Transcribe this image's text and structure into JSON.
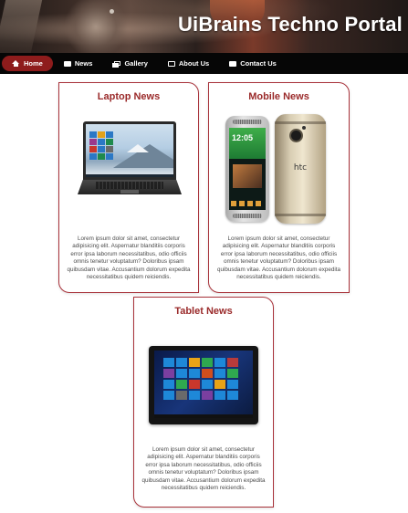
{
  "header": {
    "brand": "UiBrains Techno Portal"
  },
  "nav": [
    {
      "label": "Home",
      "icon": "home-icon",
      "active": true
    },
    {
      "label": "News",
      "icon": "newspaper-icon"
    },
    {
      "label": "Gallery",
      "icon": "gallery-icon"
    },
    {
      "label": "About Us",
      "icon": "address-card-icon"
    },
    {
      "label": "Contact Us",
      "icon": "envelope-icon"
    }
  ],
  "cards": [
    {
      "title": "Laptop News",
      "image": "laptop-image",
      "text": "Lorem ipsum dolor sit amet, consectetur adipisicing elit. Aspernatur blanditiis corporis error ipsa laborum necessitatibus, odio officiis omnis tenetur voluptatum? Doloribus ipsam quibusdam vitae. Accusantium dolorum expedita necessitatibus quidem reiciendis."
    },
    {
      "title": "Mobile News",
      "image": "smartphones-image",
      "phone_logo": "htc",
      "text": "Lorem ipsum dolor sit amet, consectetur adipisicing elit. Aspernatur blanditiis corporis error ipsa laborum necessitatibus, odio officiis omnis tenetur voluptatum? Doloribus ipsam quibusdam vitae. Accusantium dolorum expedita necessitatibus quidem reiciendis."
    },
    {
      "title": "Tablet News",
      "image": "tablet-image",
      "text": "Lorem ipsum dolor sit amet, consectetur adipisicing elit. Aspernatur blanditiis corporis error ipsa laborum necessitatibus, odio officiis omnis tenetur voluptatum? Doloribus ipsam quibusdam vitae. Accusantium dolorum expedita necessitatibus quidem reiciendis."
    }
  ],
  "colors": {
    "accent": "#8e1c1c",
    "card_border": "#a8323a",
    "nav_bg": "#060606"
  }
}
